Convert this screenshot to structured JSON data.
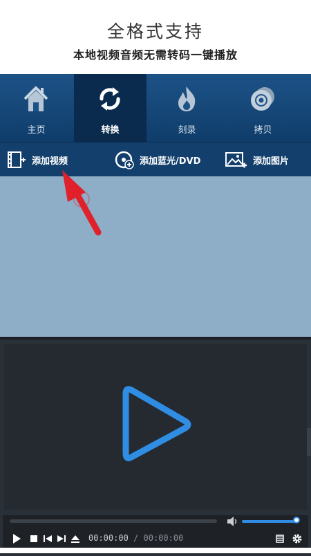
{
  "header": {
    "title": "全格式支持",
    "subtitle": "本地视频音频无需转码一键播放"
  },
  "tabs": [
    {
      "label": "主页",
      "icon": "home-icon",
      "active": false
    },
    {
      "label": "转换",
      "icon": "convert-icon",
      "active": true
    },
    {
      "label": "刻录",
      "icon": "burn-icon",
      "active": false
    },
    {
      "label": "拷贝",
      "icon": "disc-copy-icon",
      "active": false
    }
  ],
  "toolbar": {
    "add_video": "添加视频",
    "add_bluray": "添加蓝光/DVD",
    "add_image": "添加图片"
  },
  "player": {
    "current_time": "00:00:00",
    "separator": "/",
    "total_time": "00:00:00",
    "volume_level": 1.0,
    "seek_progress": 0.0
  },
  "colors": {
    "accent": "#2f8ee4",
    "tabbar": "#1d5287",
    "drop_area": "#8eadc7",
    "arrow": "#e0202a"
  }
}
